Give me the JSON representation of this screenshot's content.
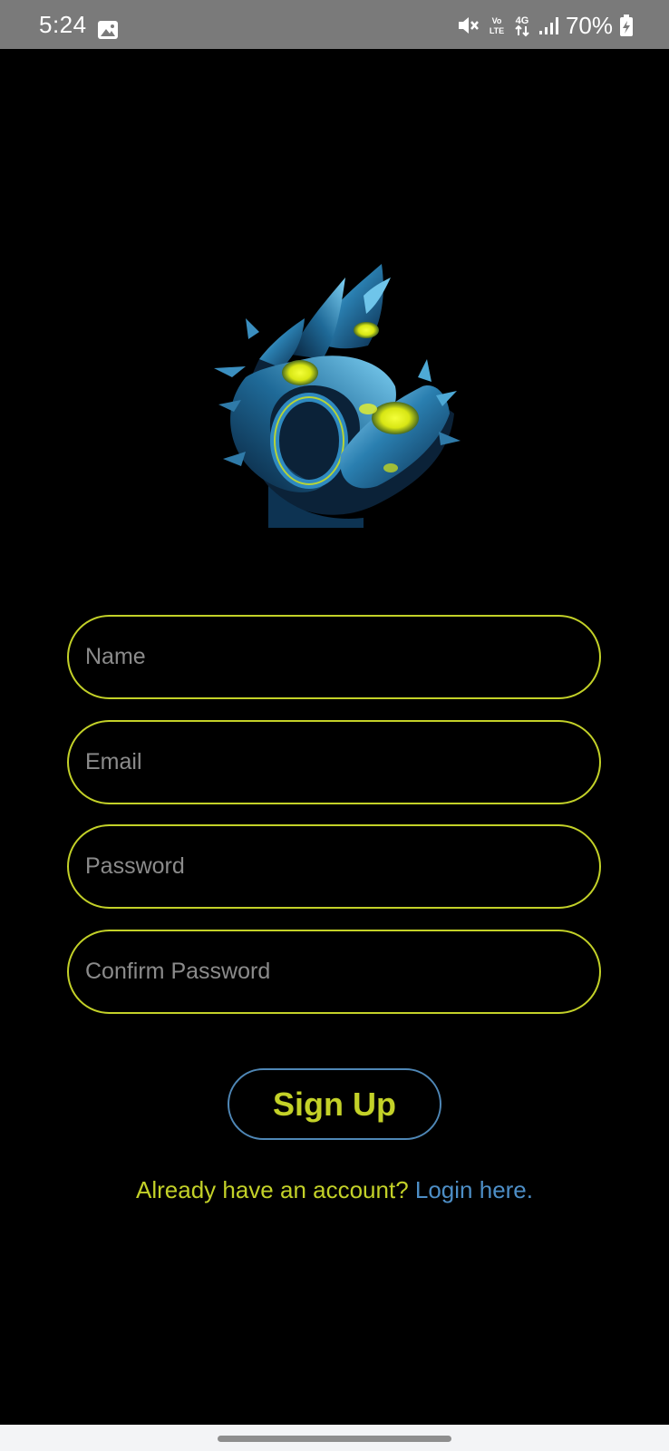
{
  "status_bar": {
    "time": "5:24",
    "gallery_icon": "image-icon",
    "mute_icon": "mute-icon",
    "volte_label": "Vo LTE",
    "network_label": "4G",
    "signal_icon": "signal-icon",
    "battery_percent": "70%",
    "battery_icon": "battery-charging-icon"
  },
  "logo": {
    "icon": "dragon-logo"
  },
  "form": {
    "name_placeholder": "Name",
    "email_placeholder": "Email",
    "password_placeholder": "Password",
    "confirm_password_placeholder": "Confirm Password",
    "signup_label": "Sign Up",
    "login_prompt": "Already have an account?",
    "login_link": "Login here."
  },
  "colors": {
    "accent_yellow": "#c3d128",
    "link_blue": "#4d8ec6",
    "button_border": "#4f87b6",
    "background": "#000000"
  }
}
